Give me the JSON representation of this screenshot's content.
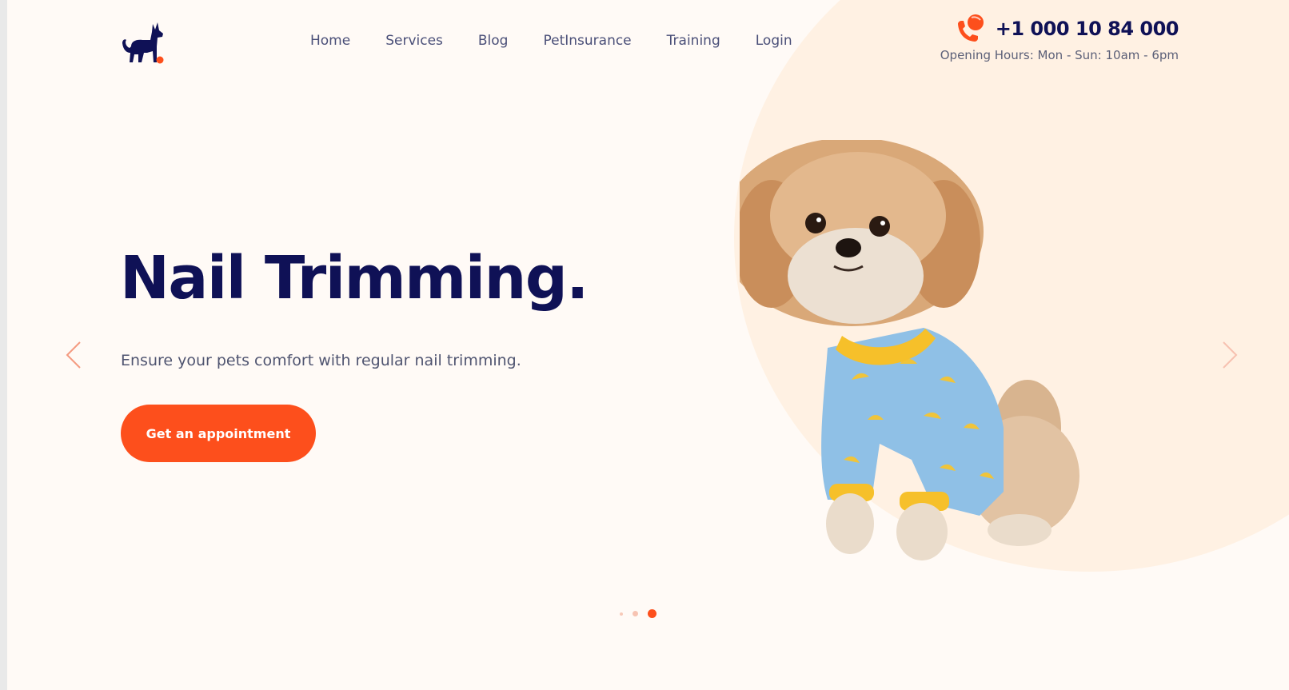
{
  "header": {
    "logo_icon": "dog-silhouette-logo-icon",
    "nav": [
      {
        "label": "Home"
      },
      {
        "label": "Services"
      },
      {
        "label": "Blog"
      },
      {
        "label": "PetInsurance"
      },
      {
        "label": "Training"
      },
      {
        "label": "Login"
      }
    ],
    "phone_icon": "phone-call-icon",
    "phone": "+1 000 10 84 000",
    "hours": "Opening Hours: Mon - Sun: 10am - 6pm"
  },
  "hero": {
    "title": "Nail Trimming.",
    "subtitle": "Ensure your pets comfort with regular nail trimming.",
    "cta_label": "Get an appointment",
    "image": "dog-in-banana-pajamas-photo"
  },
  "slider": {
    "prev_icon": "chevron-left-icon",
    "next_icon": "chevron-right-icon",
    "slide_count": 3,
    "active_slide": 3
  },
  "colors": {
    "accent": "#fd4f1c",
    "navy": "#0f1156",
    "background": "#fffaf6",
    "circle": "#fff1e3",
    "text_muted": "#4f5470"
  }
}
